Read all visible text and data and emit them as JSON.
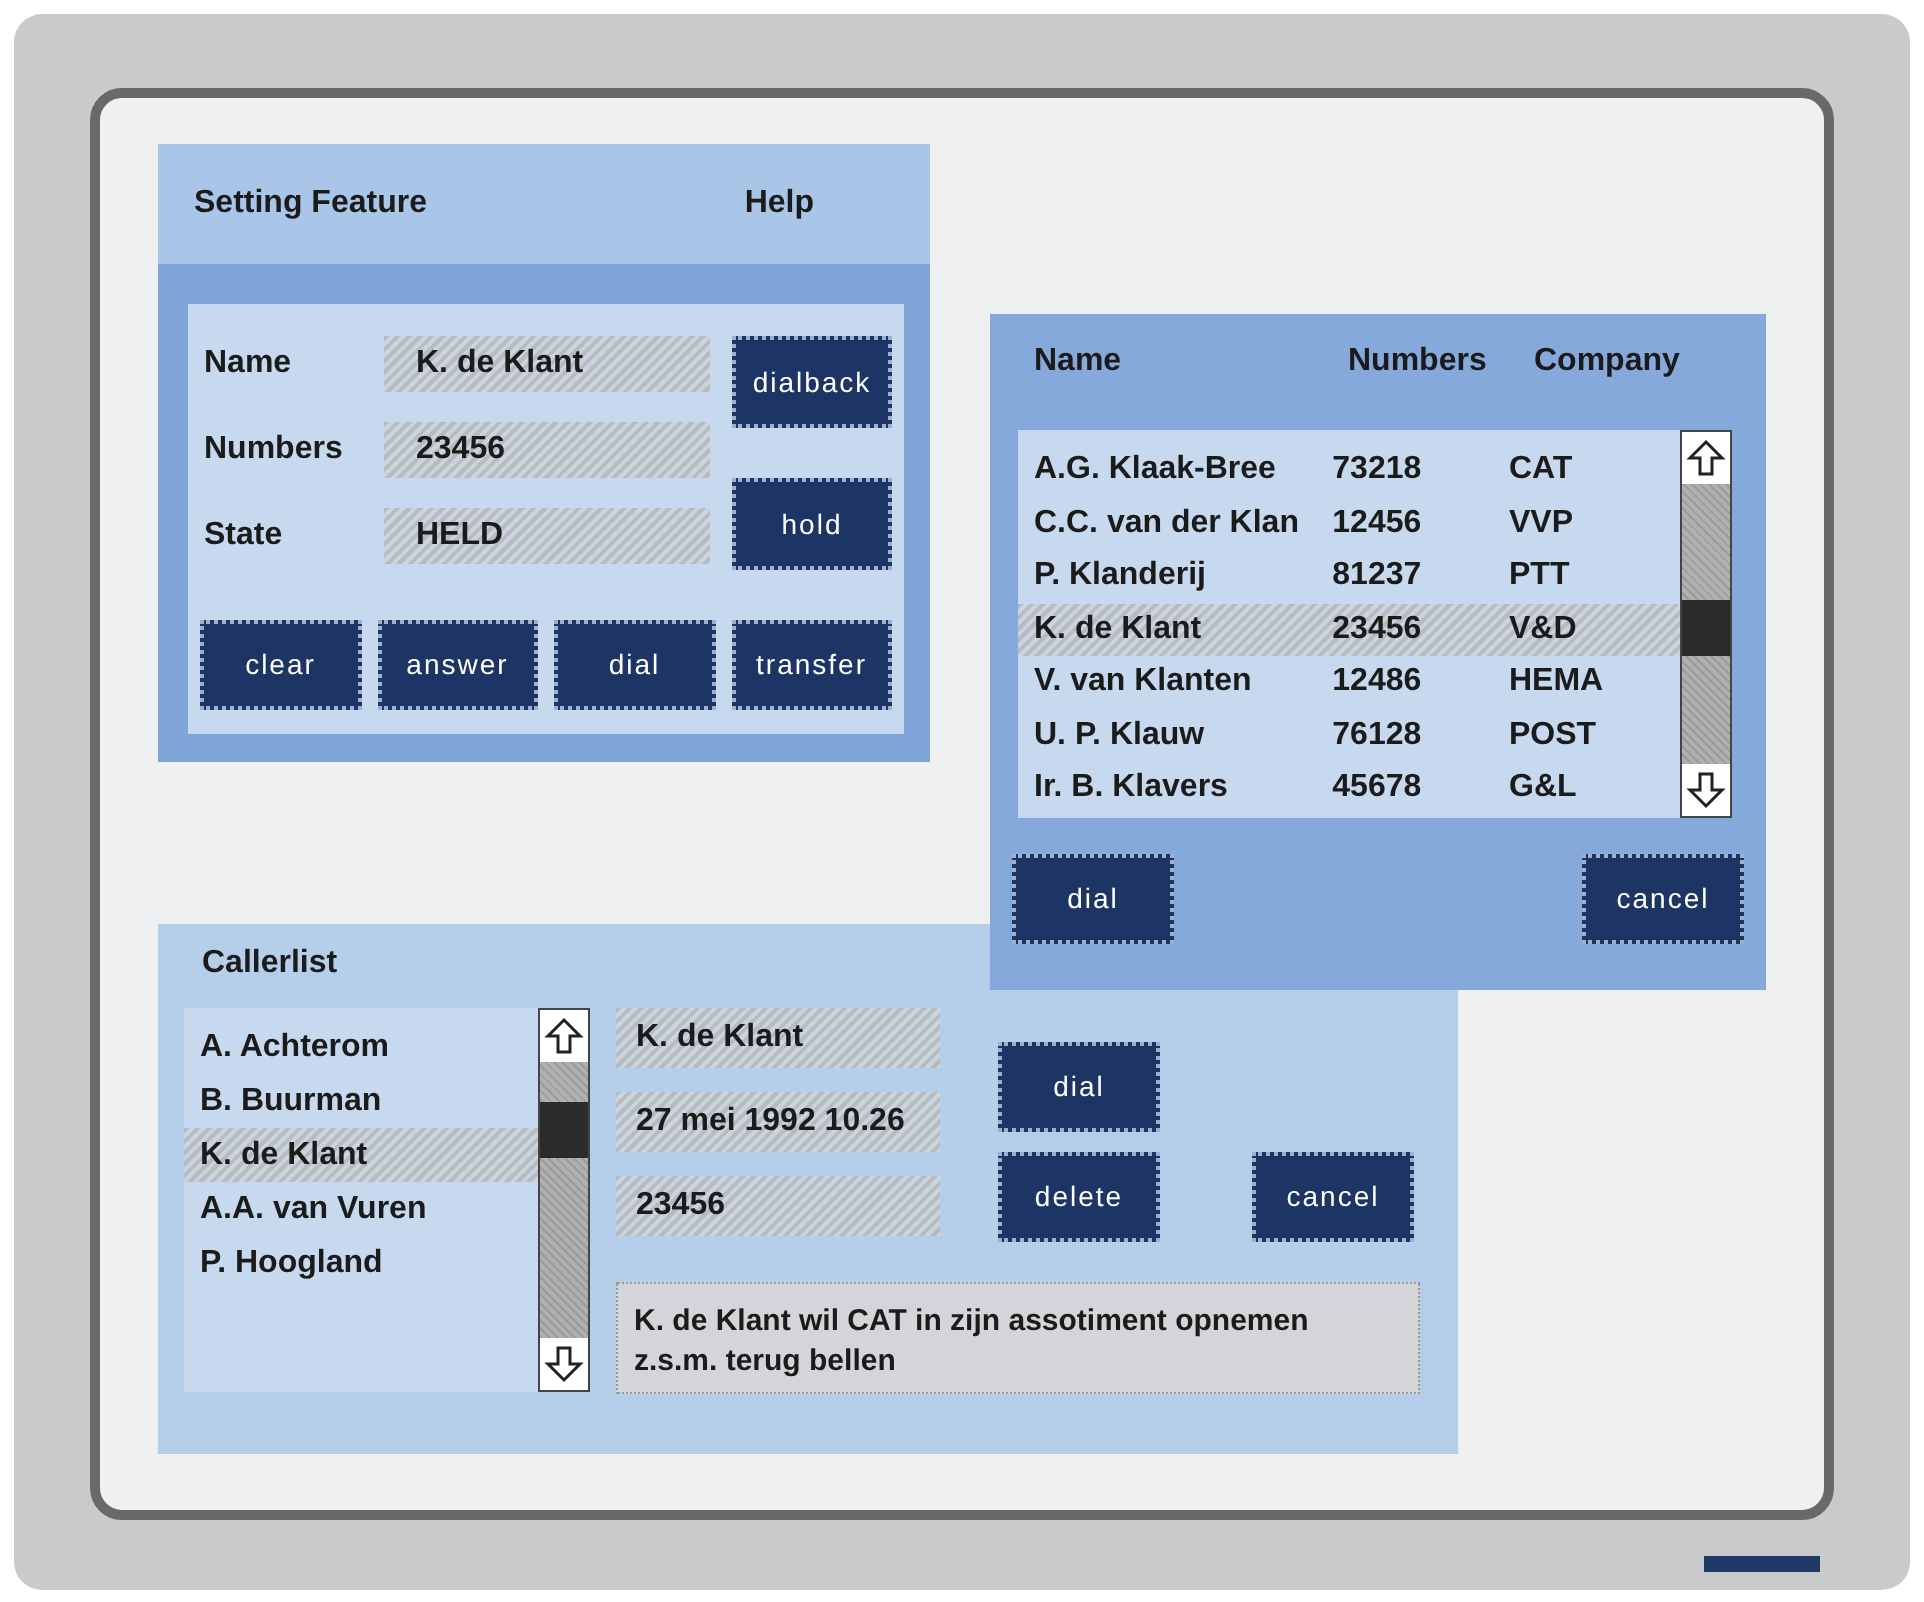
{
  "setting_feature": {
    "menu": [
      "Setting Feature",
      "Help"
    ],
    "fields": [
      {
        "label": "Name",
        "value": "K. de Klant"
      },
      {
        "label": "Numbers",
        "value": "23456"
      },
      {
        "label": "State",
        "value": "HELD"
      }
    ],
    "side_buttons": [
      "dialback",
      "hold"
    ],
    "bottom_buttons": [
      "clear",
      "answer",
      "dial",
      "transfer"
    ]
  },
  "callerlist": {
    "title": "Callerlist",
    "items": [
      {
        "label": "A. Achterom",
        "selected": false
      },
      {
        "label": "B. Buurman",
        "selected": false
      },
      {
        "label": "K. de Klant",
        "selected": true
      },
      {
        "label": "A.A. van Vuren",
        "selected": false
      },
      {
        "label": "P. Hoogland",
        "selected": false
      }
    ],
    "details": [
      "K. de Klant",
      "27 mei 1992 10.26",
      "23456"
    ],
    "note": "K. de Klant wil CAT in zijn assotiment opnemen\nz.s.m. terug bellen",
    "buttons": [
      "dial",
      "delete",
      "cancel"
    ]
  },
  "directory": {
    "columns": [
      "Name",
      "Numbers",
      "Company"
    ],
    "rows": [
      {
        "cells": [
          "A.G. Klaak-Bree",
          "73218",
          "CAT"
        ],
        "selected": false
      },
      {
        "cells": [
          "C.C. van der Klan",
          "12456",
          "VVP"
        ],
        "selected": false
      },
      {
        "cells": [
          "P. Klanderij",
          "81237",
          "PTT"
        ],
        "selected": false
      },
      {
        "cells": [
          "K. de Klant",
          "23456",
          "V&D"
        ],
        "selected": true
      },
      {
        "cells": [
          "V. van Klanten",
          "12486",
          "HEMA"
        ],
        "selected": false
      },
      {
        "cells": [
          "U. P. Klauw",
          "76128",
          "POST"
        ],
        "selected": false
      },
      {
        "cells": [
          "Ir. B. Klavers",
          "45678",
          "G&L"
        ],
        "selected": false
      }
    ],
    "buttons": [
      "dial",
      "cancel"
    ]
  }
}
